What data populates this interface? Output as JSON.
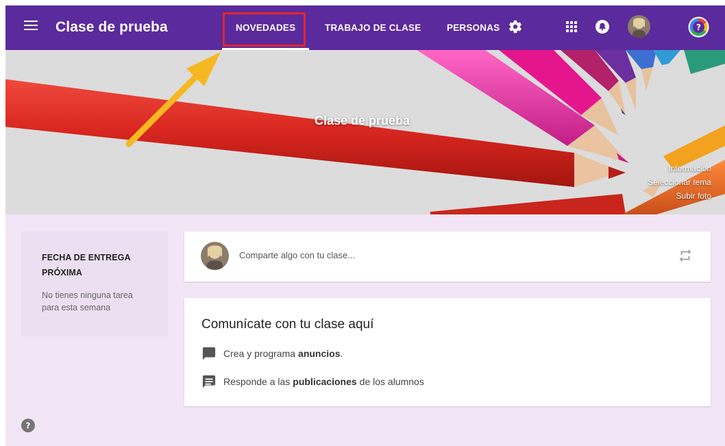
{
  "header": {
    "title": "Clase de prueba",
    "tabs": [
      {
        "label": "NOVEDADES",
        "active": true
      },
      {
        "label": "TRABAJO DE CLASE",
        "active": false
      },
      {
        "label": "PERSONAS",
        "active": false
      }
    ],
    "icons": [
      "menu-icon",
      "gear-icon",
      "apps-grid-icon",
      "notification-bell-icon",
      "avatar",
      "help-icon"
    ],
    "color": "#5b2a9c"
  },
  "banner": {
    "title": "Clase de prueba",
    "links": [
      "Información",
      "Seleccionar tema",
      "Subir foto"
    ]
  },
  "due": {
    "title_line1": "FECHA DE ENTREGA",
    "title_line2": "PRÓXIMA",
    "text_line1": "No tienes ninguna tarea",
    "text_line2": "para esta semana"
  },
  "share": {
    "placeholder": "Comparte algo con tu clase..."
  },
  "communicate": {
    "title": "Comunícate con tu clase aquí",
    "line1_pre": "Crea y programa",
    "line1_bold": "anuncios",
    "line1_post": ".",
    "line2_pre": "Responde a las",
    "line2_bold": "publicaciones",
    "line2_post": "de los alumnos"
  },
  "colors": {
    "accent": "#5b2a9c",
    "background": "#f2e5f6",
    "highlight": "#e3262d",
    "annotation_arrow": "#f6b820"
  }
}
